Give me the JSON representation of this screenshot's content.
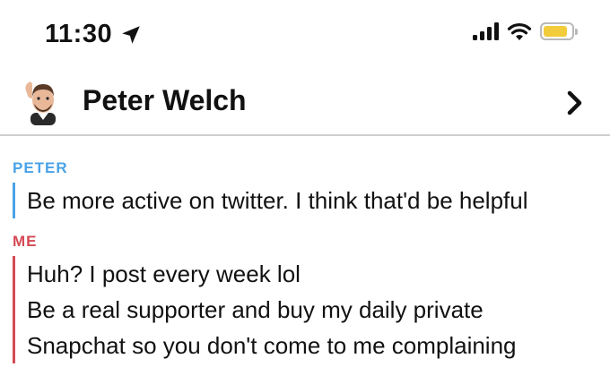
{
  "status_bar": {
    "time": "11:30",
    "location_icon": "location-arrow-icon",
    "signal_icon": "cellular-signal-icon",
    "wifi_icon": "wifi-icon",
    "battery_icon": "battery-icon",
    "battery_level": 0.85,
    "battery_color": "#f2cc3b"
  },
  "header": {
    "contact_name": "Peter Welch",
    "avatar_icon": "bitmoji-avatar",
    "chevron_icon": "chevron-right-icon"
  },
  "messages": [
    {
      "sender": "PETER",
      "color": "#4aa3e8",
      "lines": [
        "Be more active on twitter. I think that'd be helpful"
      ]
    },
    {
      "sender": "ME",
      "color": "#d44a55",
      "lines": [
        "Huh? I post every week lol",
        "Be a real supporter and buy my daily private",
        "Snapchat so you don't come to me complaining"
      ]
    }
  ]
}
